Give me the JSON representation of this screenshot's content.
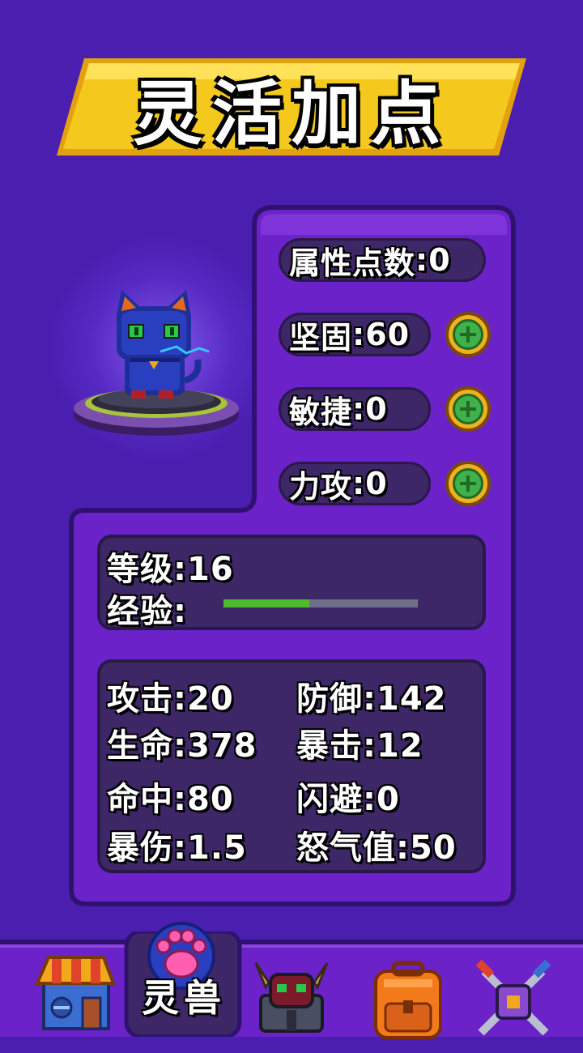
{
  "title": "灵活加点",
  "attributes": {
    "points": {
      "label": "属性点数",
      "value": "0"
    },
    "sturdy": {
      "label": "坚固",
      "value": "60"
    },
    "agility": {
      "label": "敏捷",
      "value": "0"
    },
    "power": {
      "label": "力攻",
      "value": "0"
    }
  },
  "level_box": {
    "level_label": "等级",
    "level_value": "16",
    "exp_label": "经验",
    "exp_progress": 0.44
  },
  "stats": {
    "attack": {
      "label": "攻击",
      "value": "20"
    },
    "defense": {
      "label": "防御",
      "value": "142"
    },
    "hp": {
      "label": "生命",
      "value": "378"
    },
    "crit": {
      "label": "暴击",
      "value": "12"
    },
    "hit": {
      "label": "命中",
      "value": "80"
    },
    "dodge": {
      "label": "闪避",
      "value": "0"
    },
    "crit_damage": {
      "label": "暴伤",
      "value": "1.5"
    },
    "rage": {
      "label": "怒气值",
      "value": "50"
    }
  },
  "nav": {
    "active_label": "灵兽",
    "items": [
      "shop-icon",
      "paw-icon",
      "monster-helmet-icon",
      "backpack-icon",
      "battle-swords-icon"
    ]
  },
  "colors": {
    "background": "#4a1fb0",
    "panel": "#6b22c9",
    "panel_border": "#2f1270",
    "banner_yellow": "#f2c21b",
    "exp_fill": "#4cbb2c",
    "plus_green": "#3fb04a"
  }
}
